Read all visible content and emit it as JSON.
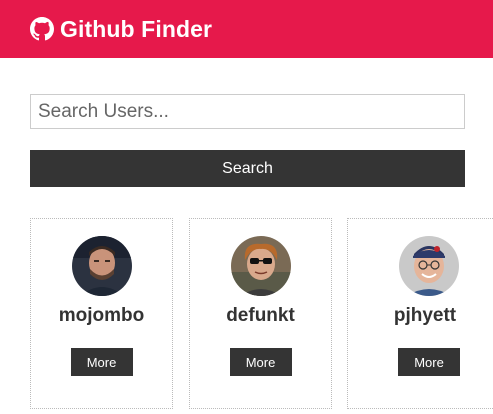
{
  "navbar": {
    "title": "Github Finder",
    "icon": "github-icon",
    "background_color": "#e6194b"
  },
  "search": {
    "placeholder": "Search Users...",
    "value": "",
    "button_label": "Search"
  },
  "users": [
    {
      "login": "mojombo",
      "more_label": "More",
      "avatar": "avatar-photo"
    },
    {
      "login": "defunkt",
      "more_label": "More",
      "avatar": "avatar-photo"
    },
    {
      "login": "pjhyett",
      "more_label": "More",
      "avatar": "avatar-photo"
    }
  ],
  "colors": {
    "accent": "#e6194b",
    "dark_button": "#343434",
    "text": "#333333"
  }
}
